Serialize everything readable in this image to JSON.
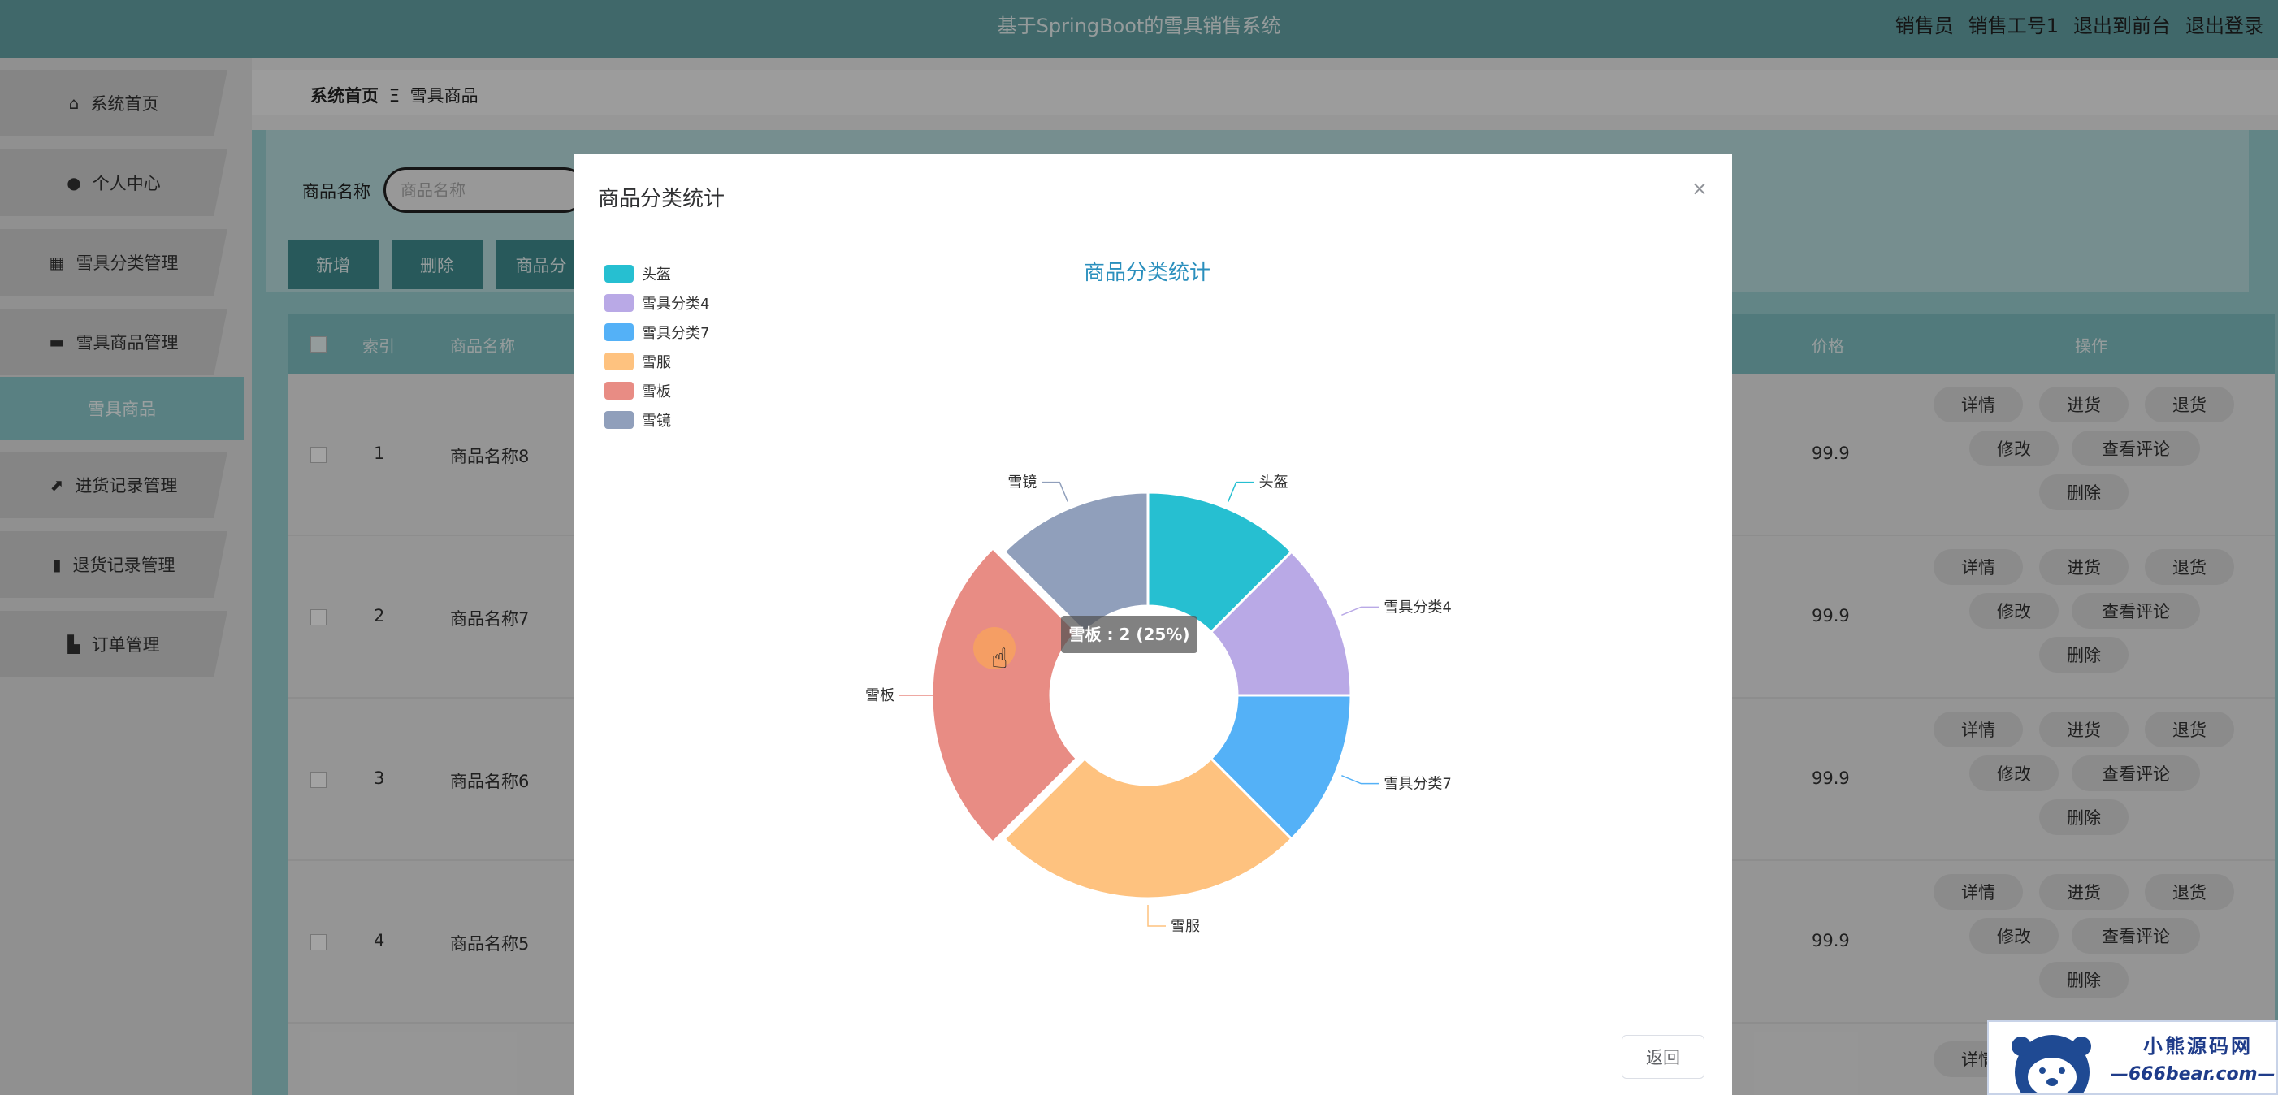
{
  "app": {
    "title": "基于SpringBoot的雪具销售系统",
    "role": "销售员",
    "user": "销售工号1",
    "exit_front": "退出到前台",
    "logout": "退出登录"
  },
  "sidebar": {
    "items": [
      {
        "label": "系统首页",
        "icon": "home-icon"
      },
      {
        "label": "个人中心",
        "icon": "user-icon"
      },
      {
        "label": "雪具分类管理",
        "icon": "grid-icon"
      },
      {
        "label": "雪具商品管理",
        "icon": "briefcase-icon"
      },
      {
        "label": "雪具商品",
        "icon": ""
      },
      {
        "label": "进货记录管理",
        "icon": "chart-icon"
      },
      {
        "label": "退货记录管理",
        "icon": "clipboard-icon"
      },
      {
        "label": "订单管理",
        "icon": "book-icon"
      }
    ]
  },
  "breadcrumb": {
    "home": "系统首页",
    "separator": "Ξ",
    "current": "雪具商品"
  },
  "search": {
    "label": "商品名称",
    "placeholder": "商品名称"
  },
  "toolbar": {
    "add": "新增",
    "delete": "删除",
    "stats": "商品分"
  },
  "table": {
    "headers": [
      "索引",
      "商品名称",
      "价格",
      "操作"
    ],
    "rows": [
      {
        "index": "1",
        "name": "商品名称8",
        "price": "99.9"
      },
      {
        "index": "2",
        "name": "商品名称7",
        "price": "99.9"
      },
      {
        "index": "3",
        "name": "商品名称6",
        "price": "99.9"
      },
      {
        "index": "4",
        "name": "商品名称5",
        "price": "99.9"
      }
    ],
    "actions": {
      "detail": "详情",
      "stock_in": "进货",
      "return": "退货",
      "edit": "修改",
      "reviews": "查看评论",
      "delete": "删除"
    }
  },
  "modal": {
    "title": "商品分类统计",
    "close": "×",
    "back": "返回",
    "tooltip": "雪板 : 2 (25%)"
  },
  "chart_data": {
    "type": "pie",
    "title": "商品分类统计",
    "legend_position": "top-left",
    "series": [
      {
        "name": "头盔",
        "value": 1,
        "color": "#26bfd1"
      },
      {
        "name": "雪具分类4",
        "value": 1,
        "color": "#b9a9e6"
      },
      {
        "name": "雪具分类7",
        "value": 1,
        "color": "#54b1f7"
      },
      {
        "name": "雪服",
        "value": 2,
        "color": "#fec27f"
      },
      {
        "name": "雪板",
        "value": 2,
        "color": "#e88c84"
      },
      {
        "name": "雪镜",
        "value": 1,
        "color": "#909fbb"
      }
    ]
  },
  "watermark": {
    "line1": "小熊源码网",
    "line2": "—666bear.com—"
  }
}
